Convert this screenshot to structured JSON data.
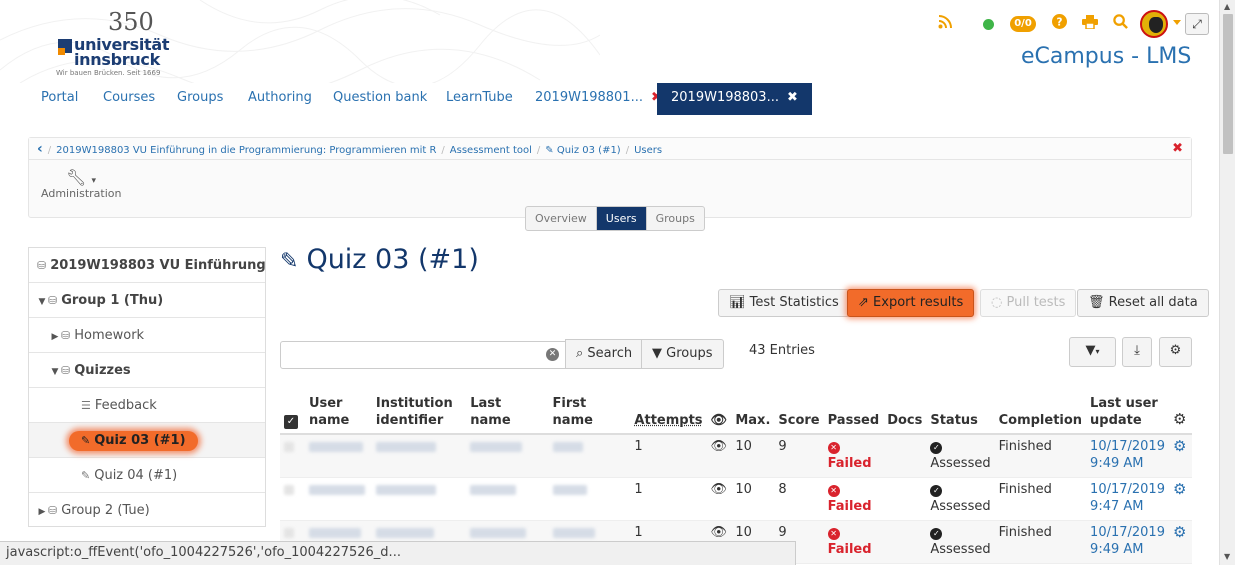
{
  "header": {
    "logo_number": "350",
    "logo_line1": "universität",
    "logo_line2": "innsbruck",
    "logo_tagline": "Wir bauen Brücken. Seit 1669",
    "app_title": "eCampus - LMS",
    "badge": "0/0",
    "expand_icon": "⤢"
  },
  "nav": {
    "items": [
      {
        "label": "Portal"
      },
      {
        "label": "Courses"
      },
      {
        "label": "Groups"
      },
      {
        "label": "Authoring"
      },
      {
        "label": "Question bank"
      },
      {
        "label": "LearnTube"
      }
    ],
    "tabs": [
      {
        "label": "2019W198801..."
      },
      {
        "label": "2019W198803..."
      }
    ],
    "close_glyph": "✖"
  },
  "breadcrumb": {
    "back": "‹",
    "items": [
      "2019W198803 VU Einführung in die Programmierung: Programmieren mit R",
      "Assessment tool",
      "Quiz 03 (#1)",
      "Users"
    ],
    "close": "✖"
  },
  "toolbar": {
    "admin_label": "Administration",
    "segments": [
      "Overview",
      "Users",
      "Groups"
    ]
  },
  "menu": {
    "items": [
      {
        "label": "2019W198803 VU Einführung"
      },
      {
        "label": "Group 1 (Thu)"
      },
      {
        "label": "Homework"
      },
      {
        "label": "Quizzes"
      },
      {
        "label": "Feedback"
      },
      {
        "label": "Quiz 03 (#1)"
      },
      {
        "label": "Quiz 04 (#1)"
      },
      {
        "label": "Group 2 (Tue)"
      }
    ]
  },
  "main": {
    "title": "Quiz 03 (#1)",
    "buttons": {
      "test_statistics": "Test Statistics",
      "export_results": "Export results",
      "pull_tests": "Pull tests",
      "reset_all": "Reset all data"
    },
    "search_label": "Search",
    "groups_label": "Groups",
    "entries": "43 Entries"
  },
  "table": {
    "headers": {
      "user_name": "User name",
      "institution": "Institution identifier",
      "last_name": "Last name",
      "first_name": "First name",
      "attempts": "Attempts",
      "max": "Max.",
      "score": "Score",
      "passed": "Passed",
      "docs": "Docs",
      "status": "Status",
      "completion": "Completion",
      "last_update": "Last user update"
    },
    "rows": [
      {
        "attempts": "1",
        "max": "10",
        "score": "9",
        "passed": "Failed",
        "status": "Assessed",
        "completion": "Finished",
        "date": "10/17/2019",
        "time": "9:49 AM"
      },
      {
        "attempts": "1",
        "max": "10",
        "score": "8",
        "passed": "Failed",
        "status": "Assessed",
        "completion": "Finished",
        "date": "10/17/2019",
        "time": "9:47 AM"
      },
      {
        "attempts": "1",
        "max": "10",
        "score": "9",
        "passed": "Failed",
        "status": "Assessed",
        "completion": "Finished",
        "date": "10/17/2019",
        "time": "9:49 AM"
      }
    ]
  },
  "statusbar": {
    "text": "javascript:o_ffEvent('ofo_1004227526','ofo_1004227526_d..."
  },
  "colors": {
    "brand": "#13376b",
    "link": "#2a71b0",
    "accent": "#f0a000",
    "danger": "#d9232d",
    "highlight": "#f26b2a"
  }
}
